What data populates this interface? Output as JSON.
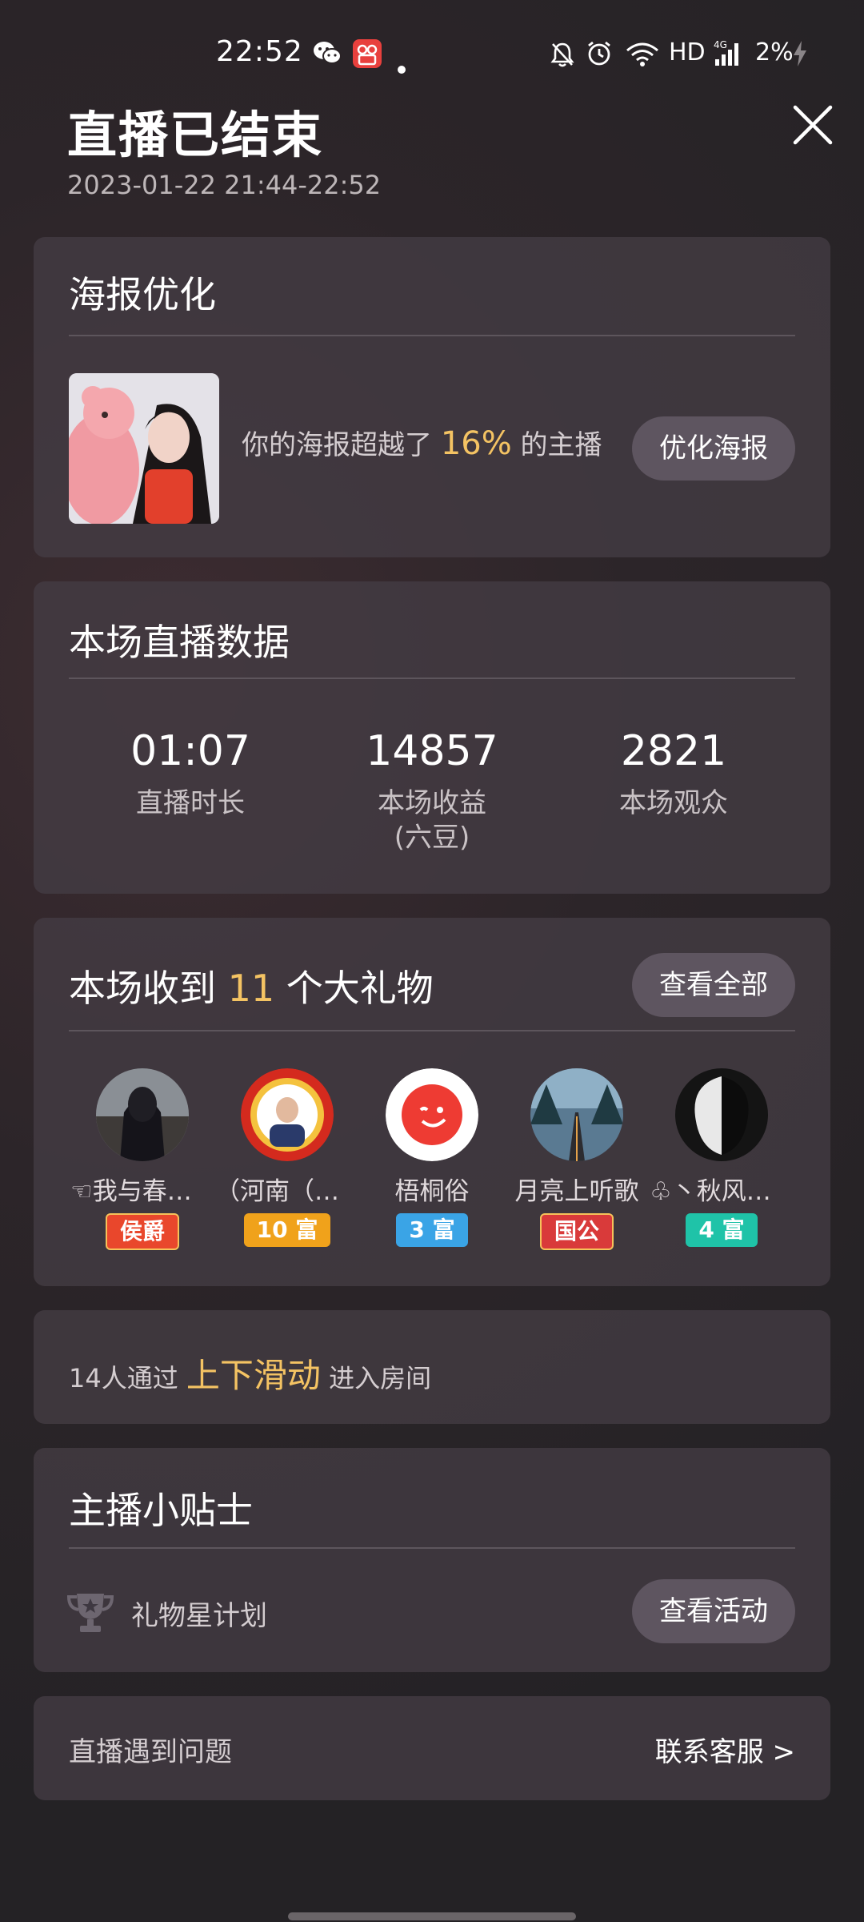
{
  "status_bar": {
    "time": "22:52",
    "network_label": "HD",
    "signal_label": "4G",
    "battery": "2%"
  },
  "header": {
    "title": "直播已结束",
    "subtitle": "2023-01-22 21:44-22:52"
  },
  "poster_card": {
    "title": "海报优化",
    "text_prefix": "你的海报超越了 ",
    "percent": "16%",
    "text_suffix": " 的主播",
    "button_label": "优化海报"
  },
  "stats_card": {
    "title": "本场直播数据",
    "stats": [
      {
        "value": "01:07",
        "label": "直播时长",
        "sublabel": ""
      },
      {
        "value": "14857",
        "label": "本场收益",
        "sublabel": "(六豆)"
      },
      {
        "value": "2821",
        "label": "本场观众",
        "sublabel": ""
      }
    ]
  },
  "gifts_card": {
    "title_prefix": "本场收到 ",
    "count": "11",
    "title_suffix": " 个大礼物",
    "button_label": "查看全部",
    "users": [
      {
        "name": "☜我与春风…",
        "badge": "侯爵",
        "badge_color": "#e9472c"
      },
      {
        "name": "（河南（杰…",
        "badge": "10 富",
        "badge_color": "#f0a21b"
      },
      {
        "name": "梧桐俗",
        "badge": "3 富",
        "badge_color": "#3aa4e6"
      },
      {
        "name": "月亮上听歌",
        "badge": "国公",
        "badge_color": "#d93a3a"
      },
      {
        "name": "♧丶秋风飘…",
        "badge": "4 富",
        "badge_color": "#1fc3a8"
      }
    ]
  },
  "swipe_card": {
    "prefix": "14人通过 ",
    "highlight": "上下滑动",
    "suffix": " 进入房间"
  },
  "tips_card": {
    "title": "主播小贴士",
    "item_label": "礼物星计划",
    "button_label": "查看活动",
    "icon": "trophy-icon"
  },
  "problem_card": {
    "label": "直播遇到问题",
    "link": "联系客服 >"
  },
  "colors": {
    "accent": "#f4c363",
    "card_bg": "#443c44",
    "button_bg": "#5e5560"
  }
}
